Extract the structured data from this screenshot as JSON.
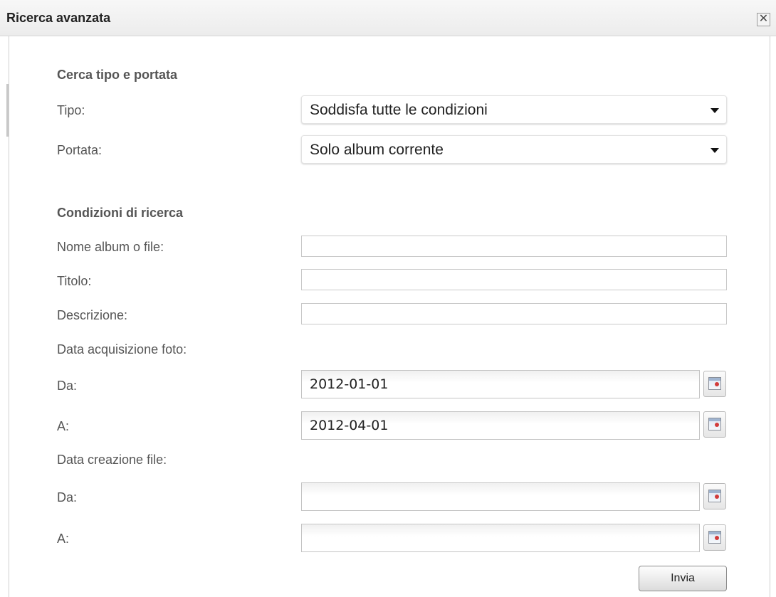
{
  "dialog": {
    "title": "Ricerca avanzata",
    "close_label": "✕"
  },
  "scope_section": {
    "heading": "Cerca tipo e portata",
    "type_label": "Tipo:",
    "type_value": "Soddisfa tutte le condizioni",
    "scope_label": "Portata:",
    "scope_value": "Solo album corrente"
  },
  "conditions_section": {
    "heading": "Condizioni di ricerca",
    "name_label": "Nome album o file:",
    "name_value": "",
    "title_label": "Titolo:",
    "title_value": "",
    "description_label": "Descrizione:",
    "description_value": "",
    "photo_date_heading": "Data acquisizione foto:",
    "photo_from_label": "Da:",
    "photo_from_value": "2012-01-01",
    "photo_to_label": "A:",
    "photo_to_value": "2012-04-01",
    "file_date_heading": "Data creazione file:",
    "file_from_label": "Da:",
    "file_from_value": "",
    "file_to_label": "A:",
    "file_to_value": ""
  },
  "submit_label": "Invia",
  "icons": {
    "close": "close-icon",
    "dropdown": "chevron-down-icon",
    "calendar": "calendar-icon"
  }
}
